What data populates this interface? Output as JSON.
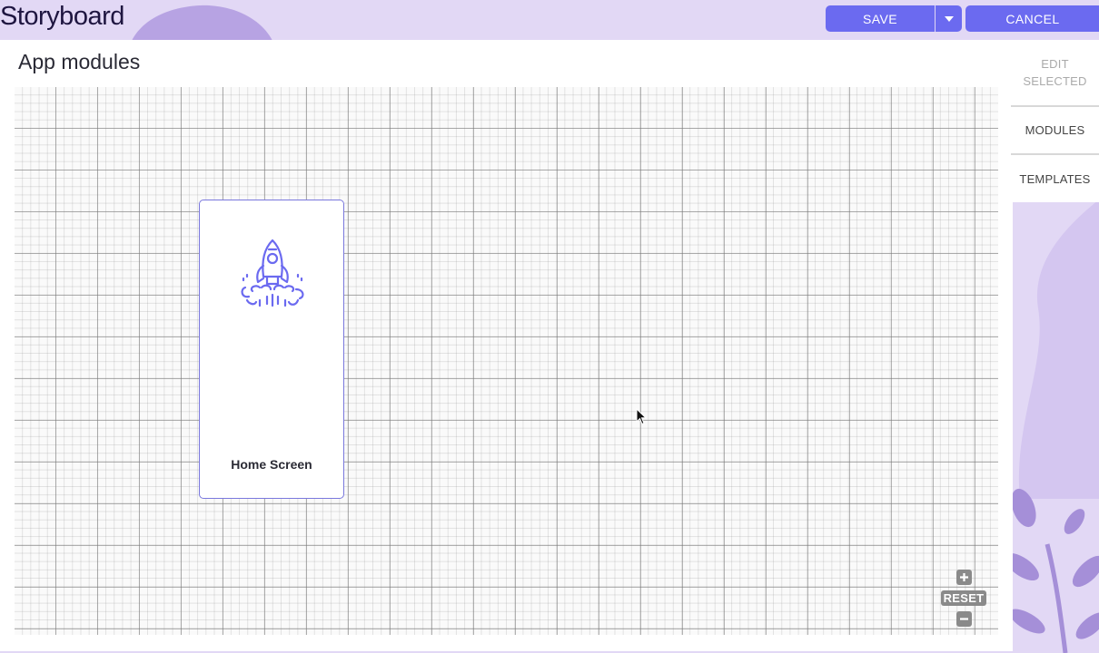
{
  "app": {
    "title": "Storyboard"
  },
  "toolbar": {
    "save_label": "SAVE",
    "cancel_label": "CANCEL",
    "dropdown_icon": "caret-down-icon"
  },
  "main": {
    "title": "App modules"
  },
  "canvas": {
    "modules": [
      {
        "label": "Home Screen",
        "icon": "rocket-icon"
      }
    ],
    "zoom": {
      "zoom_in_icon": "plus-icon",
      "reset_label": "RESET",
      "zoom_out_icon": "minus-icon"
    },
    "grid_toggle_icon": "grid-icon"
  },
  "sidebar": {
    "items": [
      {
        "label": "EDIT SELECTED",
        "state": "disabled"
      },
      {
        "label": "MODULES"
      },
      {
        "label": "TEMPLATES"
      }
    ]
  },
  "colors": {
    "accent": "#6b6af0",
    "background": "#e2d8f5",
    "decoration": "#b4a0e0"
  }
}
